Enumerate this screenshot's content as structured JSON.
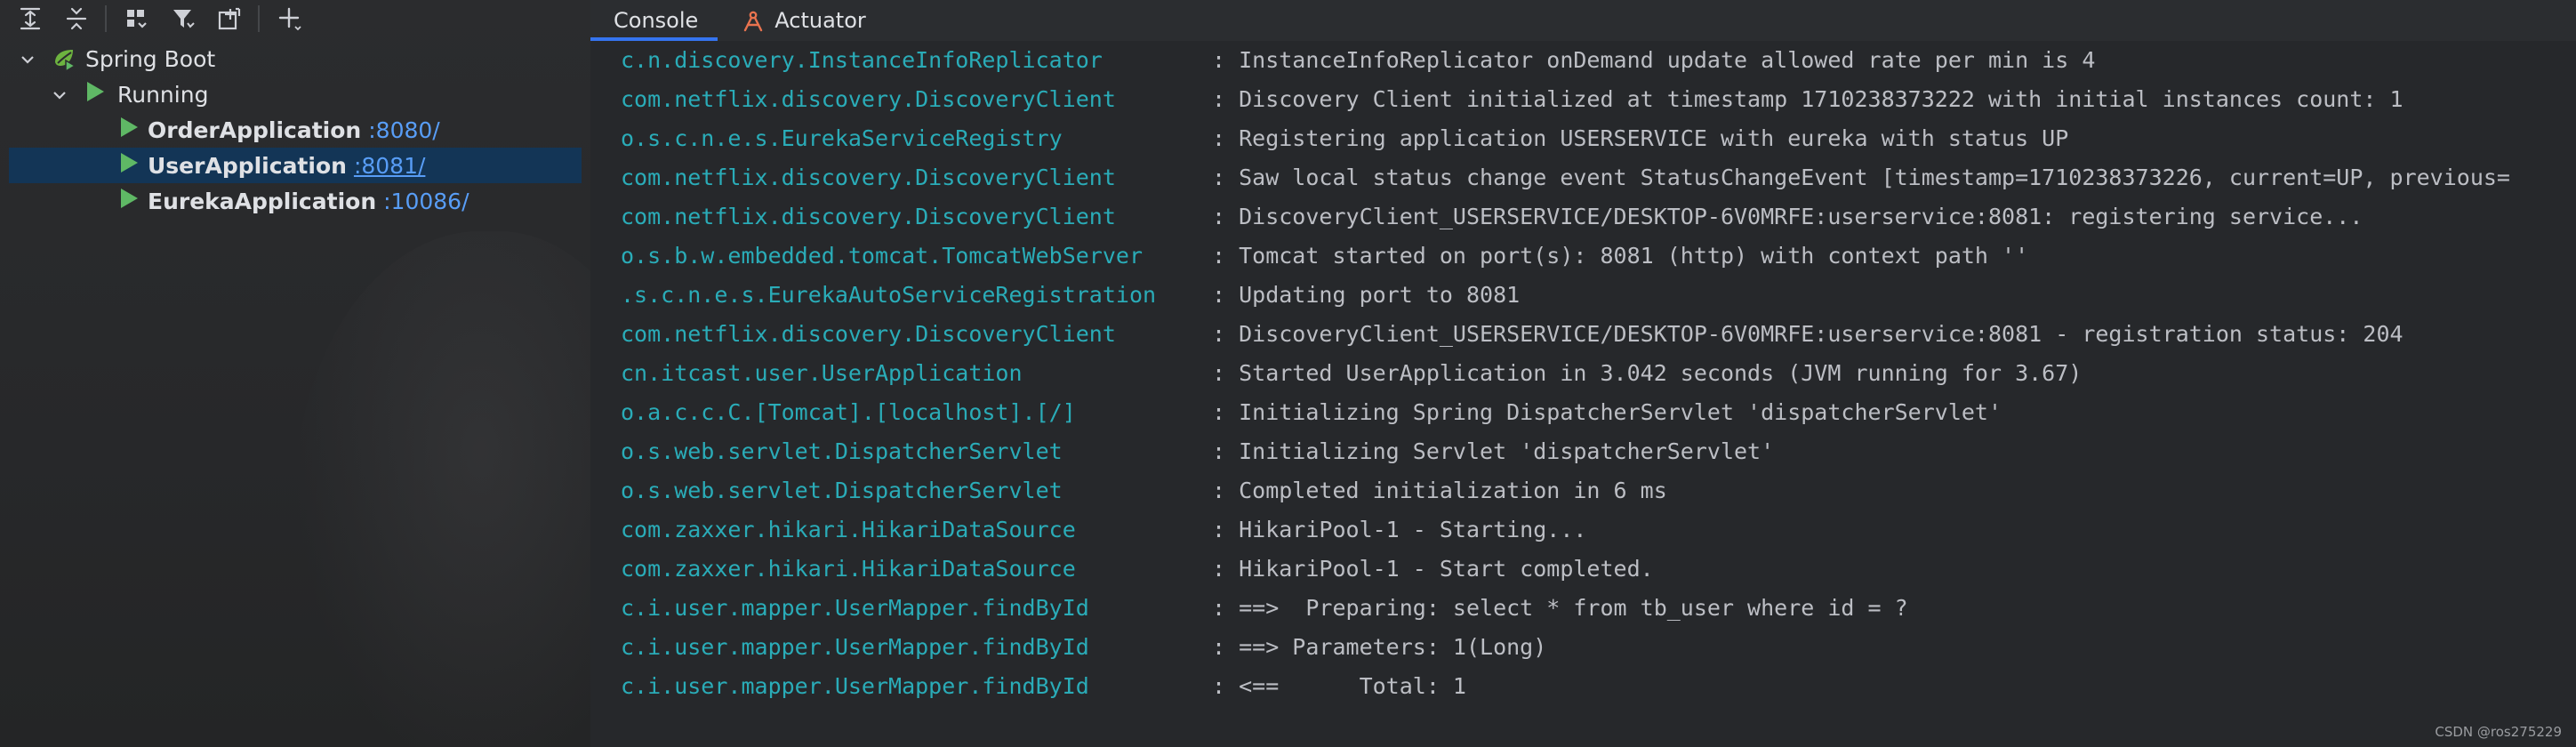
{
  "tabs": [
    {
      "label": "Console",
      "active": true
    },
    {
      "label": "Actuator",
      "active": false
    }
  ],
  "tree": {
    "root": "Spring Boot",
    "group": "Running",
    "apps": [
      {
        "name": "OrderApplication",
        "port": ":8080/",
        "selected": false
      },
      {
        "name": "UserApplication",
        "port": ":8081/",
        "selected": true
      },
      {
        "name": "EurekaApplication",
        "port": ":10086/",
        "selected": false
      }
    ]
  },
  "log": [
    {
      "logger": "c.n.discovery.InstanceInfoReplicator",
      "message": ": InstanceInfoReplicator onDemand update allowed rate per min is 4"
    },
    {
      "logger": "com.netflix.discovery.DiscoveryClient",
      "message": ": Discovery Client initialized at timestamp 1710238373222 with initial instances count: 1"
    },
    {
      "logger": "o.s.c.n.e.s.EurekaServiceRegistry",
      "message": ": Registering application USERSERVICE with eureka with status UP"
    },
    {
      "logger": "com.netflix.discovery.DiscoveryClient",
      "message": ": Saw local status change event StatusChangeEvent [timestamp=1710238373226, current=UP, previous="
    },
    {
      "logger": "com.netflix.discovery.DiscoveryClient",
      "message": ": DiscoveryClient_USERSERVICE/DESKTOP-6V0MRFE:userservice:8081: registering service..."
    },
    {
      "logger": "o.s.b.w.embedded.tomcat.TomcatWebServer",
      "message": ": Tomcat started on port(s): 8081 (http) with context path ''"
    },
    {
      "logger": ".s.c.n.e.s.EurekaAutoServiceRegistration",
      "message": ": Updating port to 8081"
    },
    {
      "logger": "com.netflix.discovery.DiscoveryClient",
      "message": ": DiscoveryClient_USERSERVICE/DESKTOP-6V0MRFE:userservice:8081 - registration status: 204"
    },
    {
      "logger": "cn.itcast.user.UserApplication",
      "message": ": Started UserApplication in 3.042 seconds (JVM running for 3.67)"
    },
    {
      "logger": "o.a.c.c.C.[Tomcat].[localhost].[/]",
      "message": ": Initializing Spring DispatcherServlet 'dispatcherServlet'"
    },
    {
      "logger": "o.s.web.servlet.DispatcherServlet",
      "message": ": Initializing Servlet 'dispatcherServlet'"
    },
    {
      "logger": "o.s.web.servlet.DispatcherServlet",
      "message": ": Completed initialization in 6 ms"
    },
    {
      "logger": "com.zaxxer.hikari.HikariDataSource",
      "message": ": HikariPool-1 - Starting..."
    },
    {
      "logger": "com.zaxxer.hikari.HikariDataSource",
      "message": ": HikariPool-1 - Start completed."
    },
    {
      "logger": "c.i.user.mapper.UserMapper.findById",
      "message": ": ==>  Preparing: select * from tb_user where id = ?"
    },
    {
      "logger": "c.i.user.mapper.UserMapper.findById",
      "message": ": ==> Parameters: 1(Long)"
    },
    {
      "logger": "c.i.user.mapper.UserMapper.findById",
      "message": ": <==      Total: 1"
    }
  ],
  "watermark": "CSDN @ros275229",
  "colors": {
    "logger": "#2aacb8",
    "message": "#bcbec4",
    "port_link": "#589df6",
    "run_green": "#5fb865",
    "selection": "#133556",
    "tab_underline": "#3574f0"
  },
  "icons": [
    "expand-all-icon",
    "collapse-all-icon",
    "group-by-icon",
    "filter-icon",
    "new-tab-icon",
    "add-icon",
    "chevron-down-icon",
    "spring-boot-icon",
    "run-icon",
    "actuator-icon"
  ]
}
